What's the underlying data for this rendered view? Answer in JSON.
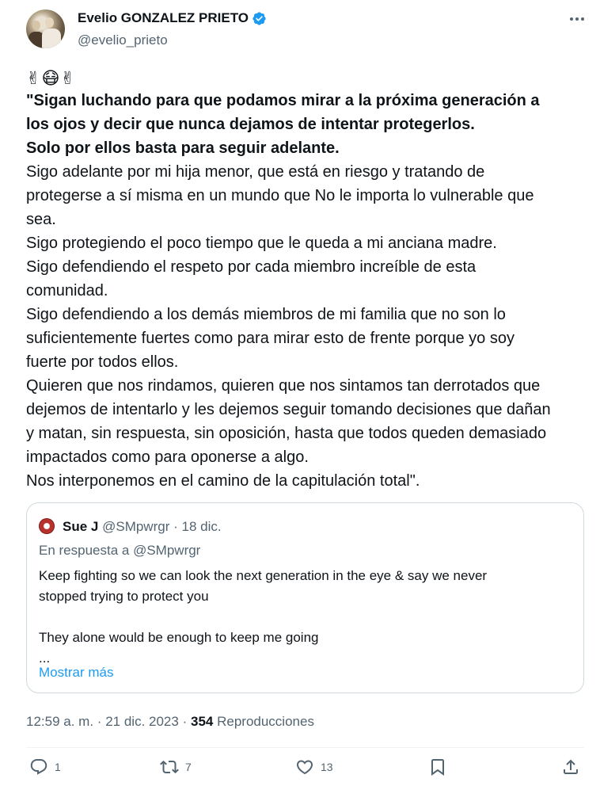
{
  "author": {
    "name": "Evelio GONZALEZ PRIETO",
    "handle": "@evelio_prieto",
    "verified_icon": "verified-badge-icon"
  },
  "body": {
    "emoji": "✌😷✌",
    "lines": [
      "\"Sigan luchando para que podamos mirar a la próxima generación a",
      "los ojos y decir que nunca dejamos de intentar protegerlos.",
      "Solo por ellos basta para seguir adelante.",
      "Sigo adelante por mi hija menor, que está en riesgo y tratando de",
      "protegerse a sí misma en un mundo que No le importa lo vulnerable que",
      "sea.",
      "Sigo protegiendo el poco tiempo que le queda a mi anciana madre.",
      "Sigo defendiendo el respeto por cada miembro increíble de esta",
      "comunidad.",
      "Sigo defendiendo a los demás miembros de mi familia que no son lo",
      "suficientemente fuertes como para mirar esto de frente porque yo soy",
      "fuerte por todos ellos.",
      "Quieren que nos rindamos, quieren que nos sintamos tan derrotados que",
      "dejemos de intentarlo y les dejemos seguir tomando decisiones que dañan",
      "y matan, sin respuesta, sin oposición, hasta que todos queden demasiado",
      "impactados como para oponerse a algo.",
      "Nos interponemos en el camino de la capitulación total\"."
    ]
  },
  "quote": {
    "name": "Sue J",
    "handle": "@SMpwrgr",
    "separator": "·",
    "date": "18 dic.",
    "reply_to": "En respuesta a @SMpwrgr",
    "lines": [
      "Keep fighting so we can look the next generation in the eye & say we never",
      "stopped trying to protect you",
      "",
      "They alone would be enough to keep me going",
      "..."
    ],
    "show_more": "Mostrar más"
  },
  "meta": {
    "time": "12:59 a. m.",
    "separator": "·",
    "date": "21 dic. 2023",
    "views_count": "354",
    "views_label": "Reproducciones"
  },
  "actions": {
    "replies": "1",
    "retweets": "7",
    "likes": "13"
  },
  "colors": {
    "text": "#0f1419",
    "secondary": "#536471",
    "accent": "#1d9bf0",
    "border": "#cfd9de"
  }
}
